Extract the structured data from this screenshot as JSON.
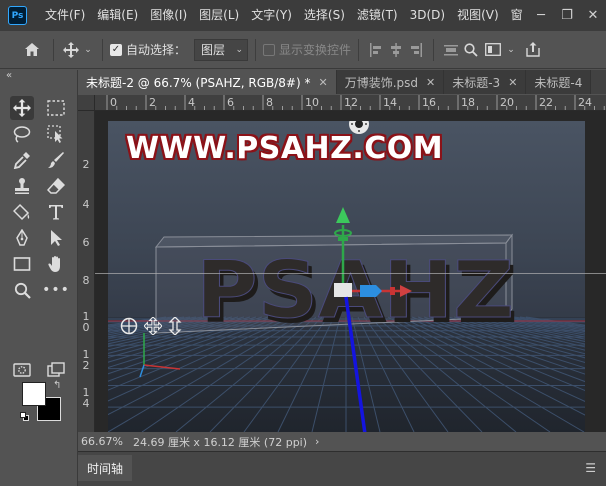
{
  "app": {
    "logo": "Ps",
    "menus": [
      "文件(F)",
      "编辑(E)",
      "图像(I)",
      "图层(L)",
      "文字(Y)",
      "选择(S)",
      "滤镜(T)",
      "3D(D)",
      "视图(V)",
      "窗"
    ],
    "window_controls": [
      "minimize",
      "restore",
      "close"
    ]
  },
  "options": {
    "auto_select_label": "自动选择：",
    "auto_select_checked": true,
    "layer_select_value": "图层",
    "show_transform_label": "显示变换控件",
    "show_transform_checked": false
  },
  "tabs": [
    {
      "label": "未标题-2 @ 66.7% (PSAHZ, RGB/8#) *",
      "active": true
    },
    {
      "label": "万博装饰.psd",
      "active": false
    },
    {
      "label": "未标题-3",
      "active": false
    },
    {
      "label": "未标题-4",
      "active": false
    }
  ],
  "rulers": {
    "top": [
      "0",
      "2",
      "4",
      "6",
      "8",
      "10",
      "12",
      "14",
      "16",
      "18",
      "20",
      "22",
      "24"
    ],
    "left": [
      "2",
      "4",
      "6",
      "8",
      "1\n0",
      "1\n2",
      "1\n4"
    ]
  },
  "canvas": {
    "watermark_text": "WWW.PSAHZ.COM",
    "text_3d": "PSAHZ",
    "colors": {
      "background_top": "#4a5463",
      "background_bottom": "#262b33",
      "watermark_fill": "#ffffff",
      "watermark_stroke": "#8b1218",
      "text_3d_fill": "#2e2b2a",
      "grid_line": "#3c4f6a",
      "horizon_line": "#a03040",
      "axis_x": "#d03838",
      "axis_y": "#2ea84a",
      "axis_z": "#1414e0"
    }
  },
  "status": {
    "zoom": "66.67%",
    "doc_info": "24.69 厘米 x 16.12 厘米 (72 ppi)",
    "more_arrow": "›"
  },
  "timeline": {
    "label": "时间轴"
  },
  "tools": [
    "move-tool",
    "marquee-tool",
    "lasso-tool",
    "object-select-tool",
    "eyedropper-tool",
    "brush-tool",
    "stamp-tool",
    "eraser-tool",
    "paint-bucket-tool",
    "type-tool",
    "pen-tool",
    "path-select-tool",
    "rectangle-tool",
    "hand-tool",
    "zoom-tool",
    "more-tools"
  ]
}
